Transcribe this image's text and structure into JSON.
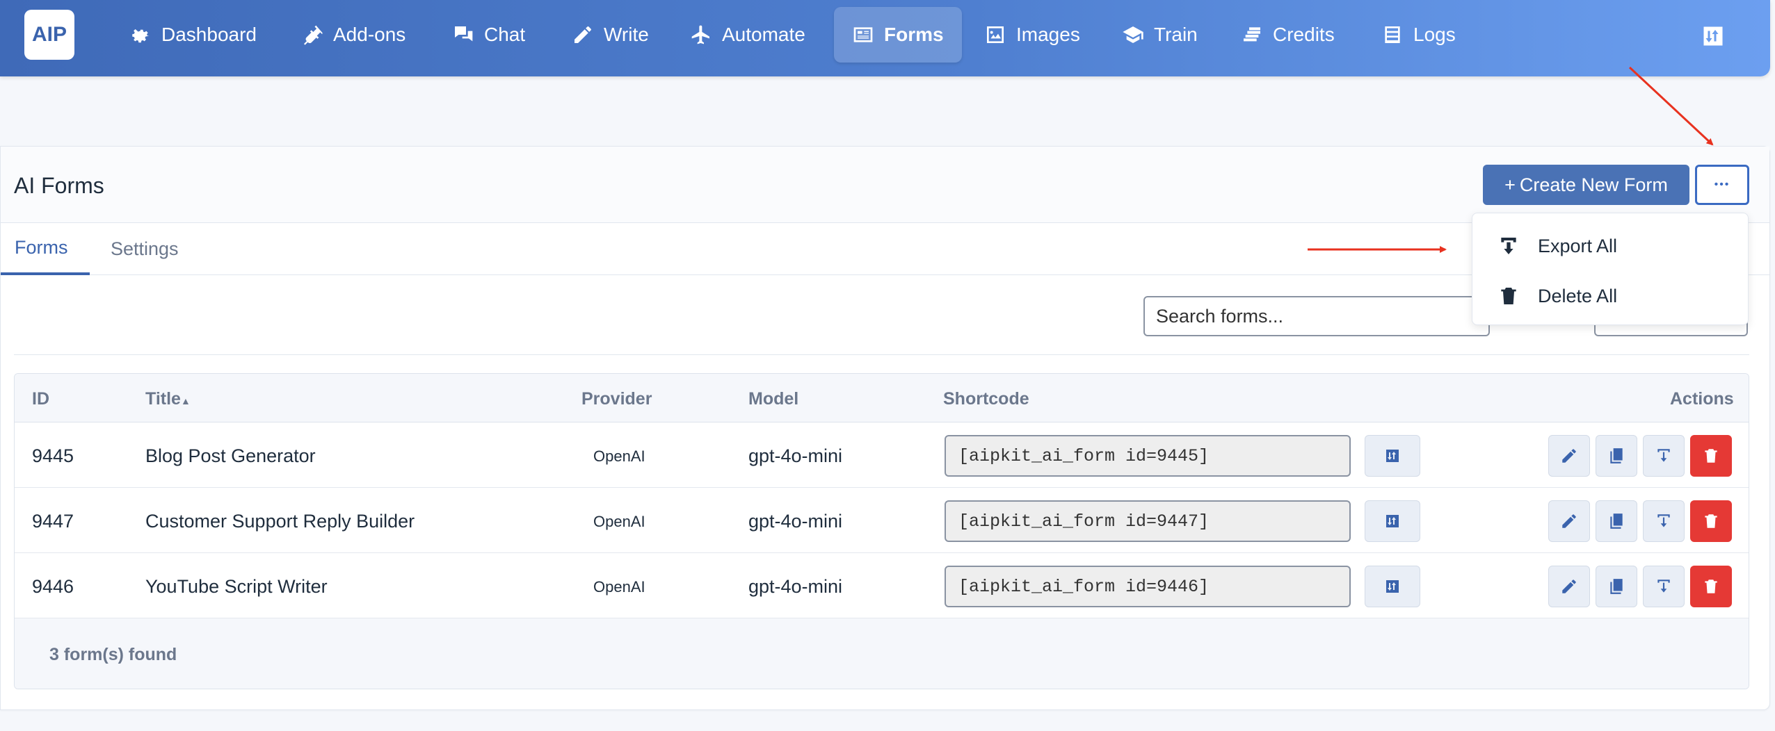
{
  "app": {
    "logo_text": "AIP"
  },
  "nav": {
    "items": [
      {
        "label": "Dashboard",
        "icon": "gear-icon"
      },
      {
        "label": "Add-ons",
        "icon": "plug-icon"
      },
      {
        "label": "Chat",
        "icon": "chat-icon"
      },
      {
        "label": "Write",
        "icon": "pencil-icon"
      },
      {
        "label": "Automate",
        "icon": "plane-icon"
      },
      {
        "label": "Forms",
        "icon": "form-icon",
        "active": true
      },
      {
        "label": "Images",
        "icon": "image-icon"
      },
      {
        "label": "Train",
        "icon": "graduation-cap-icon"
      },
      {
        "label": "Credits",
        "icon": "coins-icon"
      },
      {
        "label": "Logs",
        "icon": "list-icon"
      }
    ],
    "right_icon": "transfer-icon"
  },
  "header": {
    "title": "AI Forms",
    "create_button": "Create New Form",
    "create_button_prefix": "+",
    "more_button": "•••"
  },
  "tabs": [
    {
      "label": "Forms",
      "active": true
    },
    {
      "label": "Settings",
      "active": false
    }
  ],
  "search": {
    "placeholder": "Search forms..."
  },
  "dropdown": {
    "items": [
      {
        "label": "Export All",
        "icon": "export-icon"
      },
      {
        "label": "Delete All",
        "icon": "trash-icon"
      }
    ]
  },
  "table": {
    "columns": [
      "ID",
      "Title",
      "Provider",
      "Model",
      "Shortcode",
      "Actions"
    ],
    "sort_indicator": "▲",
    "rows": [
      {
        "id": "9445",
        "title": "Blog Post Generator",
        "provider": "OpenAI",
        "model": "gpt-4o-mini",
        "shortcode": "[aipkit_ai_form id=9445]"
      },
      {
        "id": "9447",
        "title": "Customer Support Reply Builder",
        "provider": "OpenAI",
        "model": "gpt-4o-mini",
        "shortcode": "[aipkit_ai_form id=9447]"
      },
      {
        "id": "9446",
        "title": "YouTube Script Writer",
        "provider": "OpenAI",
        "model": "gpt-4o-mini",
        "shortcode": "[aipkit_ai_form id=9446]"
      }
    ],
    "footer": "3 form(s) found"
  },
  "colors": {
    "nav_start": "#3f6ab8",
    "nav_end": "#6c9ff0",
    "accent": "#4a72b5",
    "danger": "#e53935",
    "annotation_arrow": "#e8321f"
  }
}
